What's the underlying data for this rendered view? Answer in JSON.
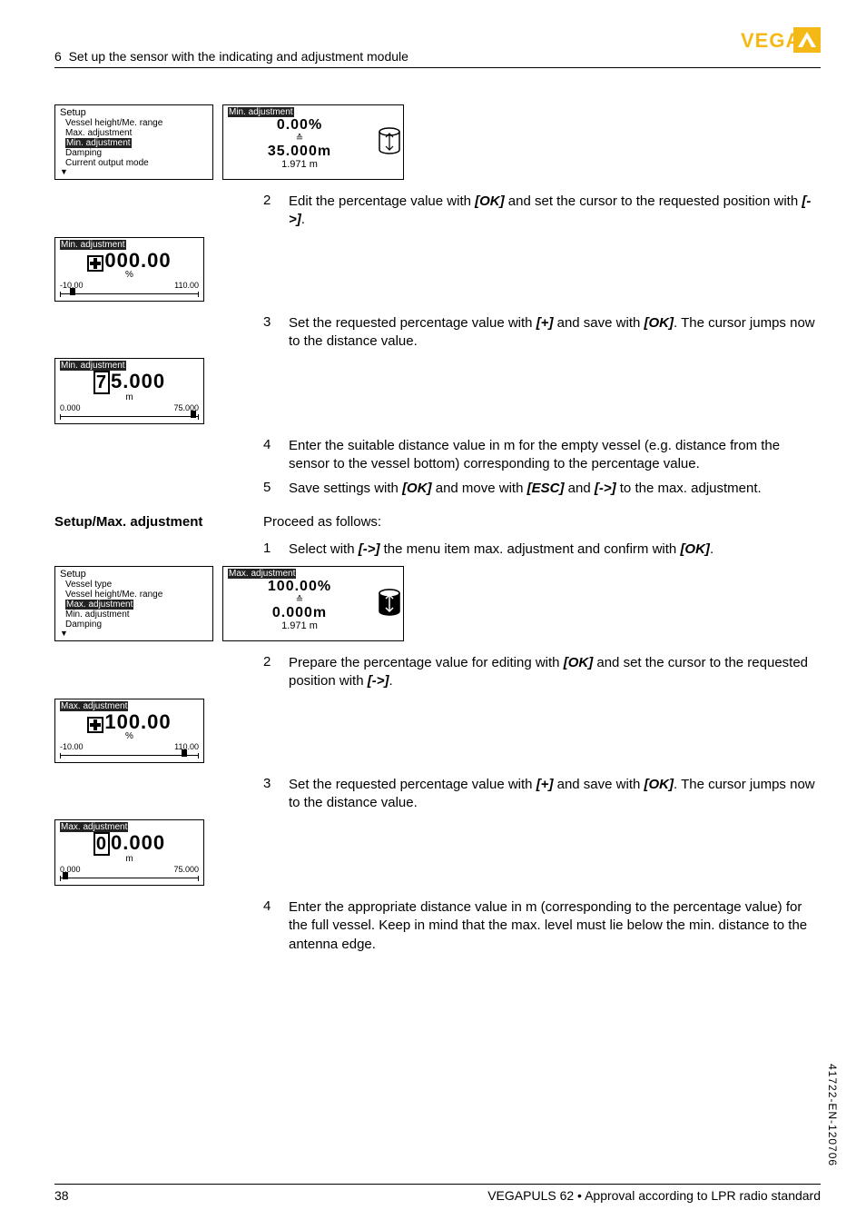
{
  "header": {
    "section_num": "6",
    "section_title": "Set up the sensor with the indicating and adjustment module"
  },
  "screens": {
    "setup1": {
      "title": "Setup",
      "items": [
        "Vessel height/Me. range",
        "Max. adjustment",
        "Min. adjustment",
        "Damping",
        "Current output mode"
      ],
      "highlight_index": 2
    },
    "min_view": {
      "title": "Min. adjustment",
      "pct": "0.00%",
      "dist": "35.000m",
      "sub": "1.971 m"
    },
    "min_edit_pct": {
      "title": "Min. adjustment",
      "value": "000.00",
      "unit": "%",
      "lo": "-10.00",
      "hi": "110.00"
    },
    "min_edit_val": {
      "title": "Min. adjustment",
      "value_first": "7",
      "value_rest": "5.000",
      "unit": "m",
      "lo": "0.000",
      "hi": "75.000"
    },
    "setup2": {
      "title": "Setup",
      "items": [
        "Vessel type",
        "Vessel height/Me. range",
        "Max. adjustment",
        "Min. adjustment",
        "Damping"
      ],
      "highlight_index": 2
    },
    "max_view": {
      "title": "Max. adjustment",
      "pct": "100.00%",
      "dist": "0.000m",
      "sub": "1.971 m"
    },
    "max_edit_pct": {
      "title": "Max. adjustment",
      "value": "100.00",
      "unit": "%",
      "lo": "-10.00",
      "hi": "110.00"
    },
    "max_edit_val": {
      "title": "Max. adjustment",
      "value_first": "0",
      "value_rest": "0.000",
      "unit": "m",
      "lo": "0.000",
      "hi": "75.000"
    }
  },
  "steps": {
    "s2a": "Edit the percentage value with ",
    "s2b": " and set the cursor to the requested position with ",
    "s3a": "Set the requested percentage value with ",
    "s3b": " and save with ",
    "s3c": ". The cursor jumps now to the distance value.",
    "s4": "Enter the suitable distance value in m for the empty vessel (e.g. distance from the sensor to the vessel bottom) corresponding to the percentage value.",
    "s5a": "Save settings with ",
    "s5b": " and move with ",
    "s5c": " and ",
    "s5d": " to the max. adjustment.",
    "max_s1a": "Select with ",
    "max_s1b": " the menu item max. adjustment and confirm with ",
    "max_s2a": "Prepare the percentage value for editing with ",
    "max_s2b": " and set the cursor to the requested position with ",
    "max_s3a": "Set the requested percentage value with ",
    "max_s3b": " and save with ",
    "max_s3c": ". The cursor jumps now to the distance value.",
    "max_s4": "Enter the appropriate distance value in m (corresponding to the percentage value) for the full vessel. Keep in mind that the max. level must lie below the min. distance to the antenna edge."
  },
  "labels": {
    "proceed": "Proceed as follows:",
    "side_section": "Setup/Max. adjustment"
  },
  "keys": {
    "ok": "[OK]",
    "next": "[->]",
    "plus": "[+]",
    "esc": "[ESC]"
  },
  "footer": {
    "page": "38",
    "product": "VEGAPULS 62 • Approval according to LPR radio standard"
  },
  "sidecode": "41722-EN-120706"
}
